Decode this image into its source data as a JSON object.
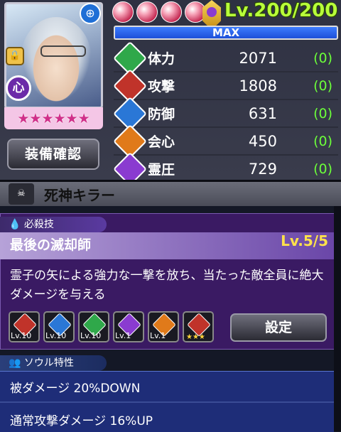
{
  "character": {
    "attribute_label": "心",
    "star_count": 6,
    "equip_button_label": "装備確認",
    "zoom_icon": "magnifier-plus-icon",
    "lock_icon": "padlock-icon"
  },
  "level": {
    "orb_count": 4,
    "text": "Lv.200/200",
    "bar_label": "MAX"
  },
  "stats": [
    {
      "label": "体力",
      "value": "2071",
      "bonus": "(0)",
      "icon": "heart-icon",
      "color": "#2fa84a"
    },
    {
      "label": "攻撃",
      "value": "1808",
      "bonus": "(0)",
      "icon": "sword-icon",
      "color": "#c0332a"
    },
    {
      "label": "防御",
      "value": "631",
      "bonus": "(0)",
      "icon": "shield-icon",
      "color": "#2a77d6"
    },
    {
      "label": "会心",
      "value": "450",
      "bonus": "(0)",
      "icon": "crit-icon",
      "color": "#e07a1a"
    },
    {
      "label": "霊圧",
      "value": "729",
      "bonus": "(0)",
      "icon": "spirit-icon",
      "color": "#8a3bd0"
    }
  ],
  "partial_header": {
    "text": "死神キラー"
  },
  "skill": {
    "tag_label": "必殺技",
    "name": "最後の滅却師",
    "level": "Lv.5/5",
    "description": "霊子の矢による強力な一撃を放ち、当たった敵全員に絶大ダメージを与える",
    "chips": [
      {
        "label": "Lv.10",
        "color": "#c0332a"
      },
      {
        "label": "Lv.10",
        "color": "#2a77d6"
      },
      {
        "label": "Lv.10",
        "color": "#2fa84a"
      },
      {
        "label": "Lv.1",
        "color": "#8a3bd0"
      },
      {
        "label": "Lv.1",
        "color": "#e07a1a"
      },
      {
        "label": "★★★",
        "color": "#c0332a"
      }
    ],
    "set_button_label": "設定"
  },
  "soul": {
    "tag_label": "ソウル特性",
    "items": [
      "被ダメージ 20%DOWN",
      "通常攻撃ダメージ 16%UP"
    ]
  }
}
